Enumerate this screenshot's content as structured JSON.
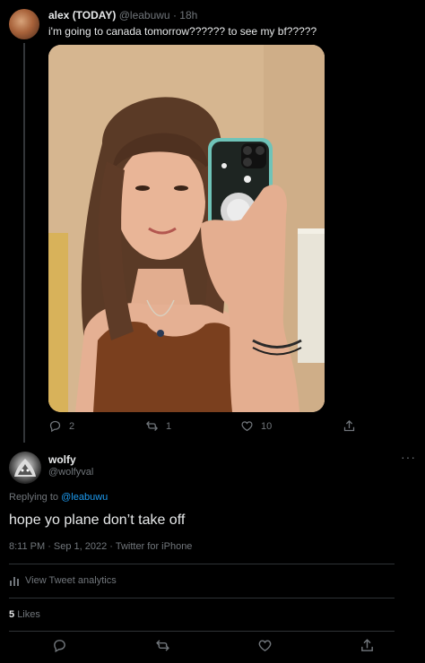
{
  "parent_tweet": {
    "display_name": "alex (TODAY)",
    "handle": "@leabuwu",
    "time": "· 18h",
    "text": "i'm going to canada tomorrow?????? to see my bf?????",
    "reply_count": "2",
    "retweet_count": "1",
    "like_count": "10"
  },
  "reply_tweet": {
    "display_name": "wolfy",
    "handle": "@wolfyval",
    "more": "···",
    "replying_prefix": "Replying to",
    "replying_handle": "@leabuwu",
    "text": "hope yo plane don’t take off",
    "timestamp": "8:11 PM · Sep 1, 2022 · Twitter for iPhone",
    "analytics_label": "View Tweet analytics",
    "likes_count": "5",
    "likes_label": "Likes"
  },
  "icons": [
    "reply-icon",
    "retweet-icon",
    "like-icon",
    "share-icon",
    "analytics-icon"
  ],
  "colors": {
    "background": "#000000",
    "text": "#e7e9ea",
    "muted": "#71767b",
    "link": "#1d9bf0"
  }
}
